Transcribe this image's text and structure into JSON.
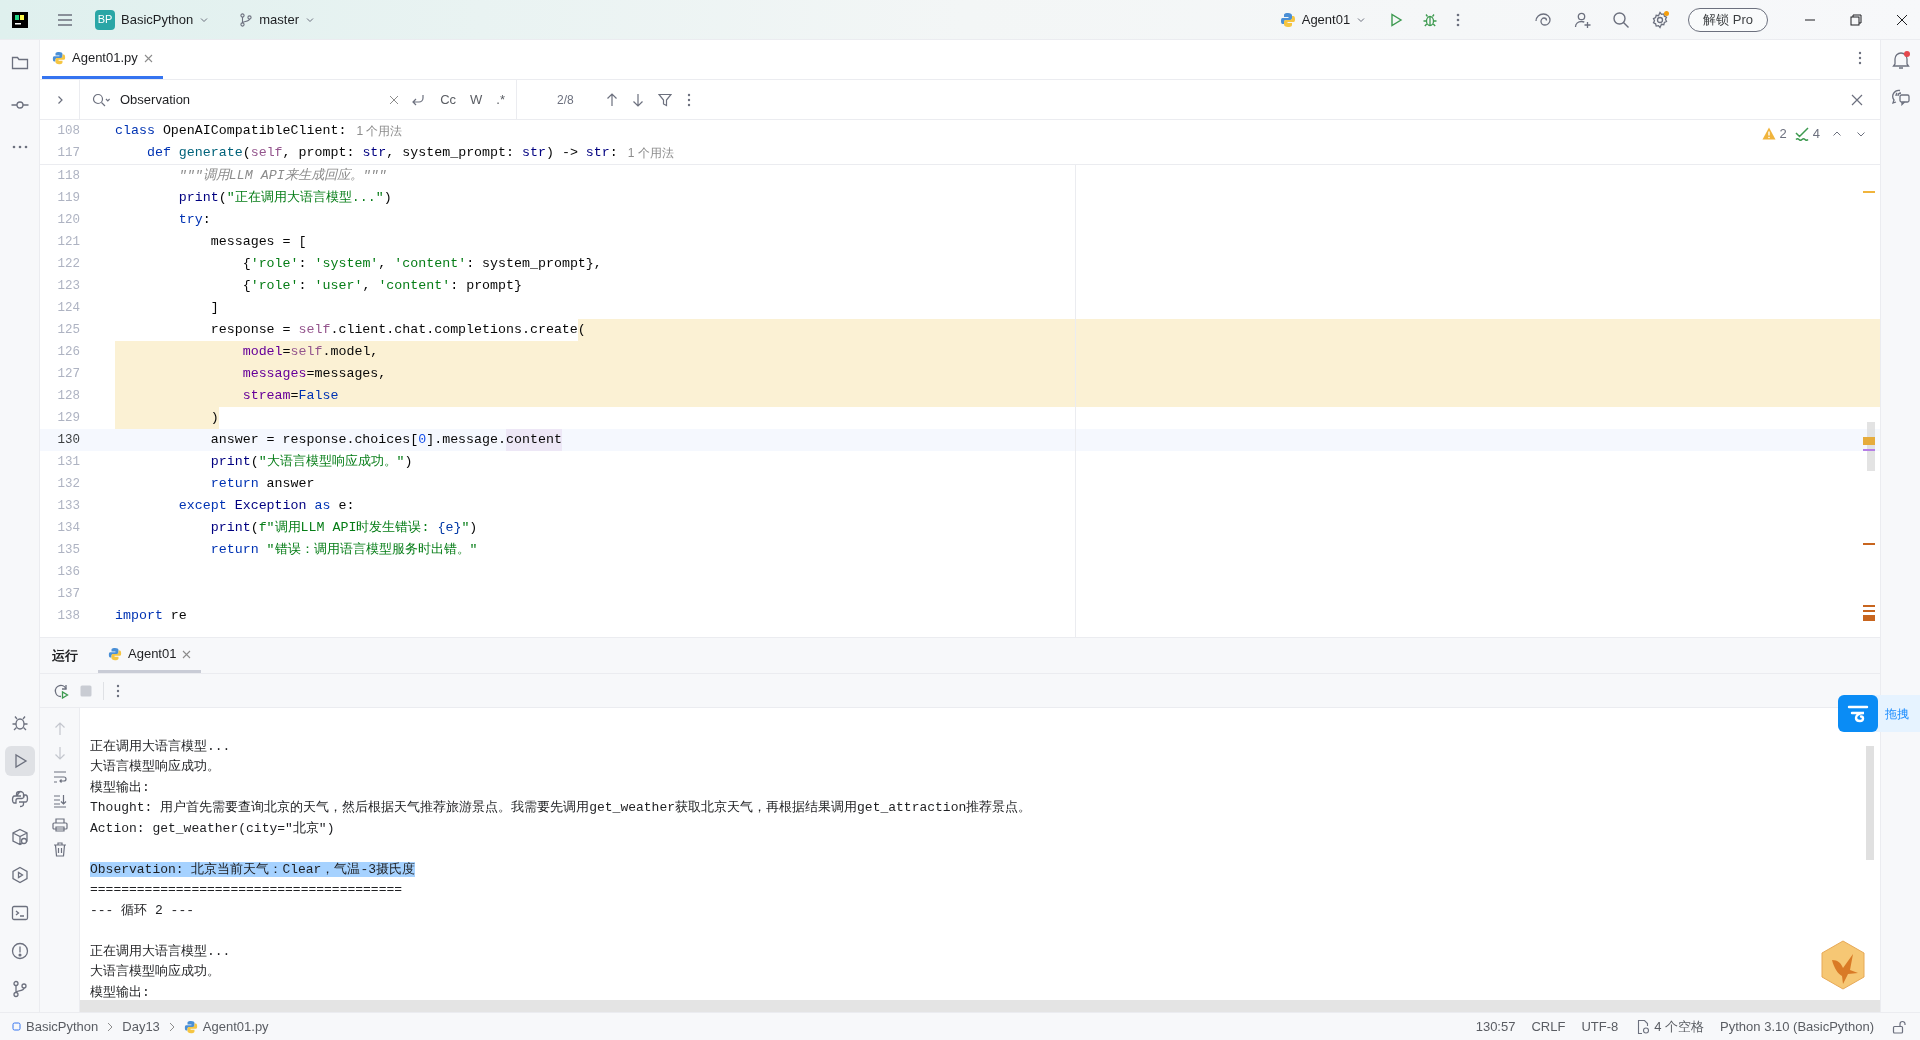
{
  "title_bar": {
    "project_badge": "BP",
    "project": "BasicPython",
    "branch": "master",
    "run_config": "Agent01",
    "pro_button": "解锁 Pro"
  },
  "left_toolbar": {
    "top": [
      {
        "kind": "folder",
        "selected": false
      },
      {
        "kind": "commit",
        "selected": false
      },
      {
        "kind": "more",
        "selected": false
      }
    ],
    "bottom": [
      {
        "kind": "bug",
        "selected": false
      },
      {
        "kind": "play",
        "selected": true
      },
      {
        "kind": "python",
        "selected": false
      },
      {
        "kind": "package",
        "selected": false
      },
      {
        "kind": "hexplay",
        "selected": false
      },
      {
        "kind": "terminal",
        "selected": false
      },
      {
        "kind": "alert",
        "selected": false
      },
      {
        "kind": "branch",
        "selected": false
      }
    ]
  },
  "editor_tabs": [
    {
      "label": "Agent01.py",
      "selected": true
    }
  ],
  "find_bar": {
    "value": "Observation",
    "options": [
      "Cc",
      "W",
      ".*"
    ],
    "match_count": "2/8"
  },
  "inspections": {
    "warnings": "2",
    "typos": "4"
  },
  "sticky_lines": [
    {
      "number": "108",
      "hint": "1 个用法",
      "tokens": [
        {
          "kind": "kw",
          "text": "class"
        },
        {
          "kind": "plain",
          "text": " OpenAICompatibleClient:"
        }
      ]
    },
    {
      "number": "117",
      "hint": "1 个用法",
      "tokens": [
        {
          "kind": "kw",
          "text": "    def"
        },
        {
          "kind": "fn",
          "text": " generate"
        },
        {
          "kind": "plain",
          "text": "("
        },
        {
          "kind": "self",
          "text": "self"
        },
        {
          "kind": "plain",
          "text": ", prompt: "
        },
        {
          "kind": "builtin",
          "text": "str"
        },
        {
          "kind": "plain",
          "text": ", system_prompt: "
        },
        {
          "kind": "builtin",
          "text": "str"
        },
        {
          "kind": "plain",
          "text": ") -> "
        },
        {
          "kind": "builtin",
          "text": "str"
        },
        {
          "kind": "plain",
          "text": ":"
        }
      ]
    }
  ],
  "code_lines": [
    {
      "number": "118",
      "tokens": [
        {
          "kind": "doc",
          "text": "        \"\"\"调用LLM API来生成回应。\"\"\""
        }
      ]
    },
    {
      "number": "119",
      "tokens": [
        {
          "kind": "builtin",
          "text": "        print"
        },
        {
          "kind": "plain",
          "text": "("
        },
        {
          "kind": "str",
          "text": "\"正在调用大语言模型...\""
        },
        {
          "kind": "plain",
          "text": ")"
        }
      ]
    },
    {
      "number": "120",
      "tokens": [
        {
          "kind": "kw",
          "text": "        try"
        },
        {
          "kind": "plain",
          "text": ":"
        }
      ]
    },
    {
      "number": "121",
      "tokens": [
        {
          "kind": "plain",
          "text": "            messages = ["
        }
      ]
    },
    {
      "number": "122",
      "tokens": [
        {
          "kind": "plain",
          "text": "                {"
        },
        {
          "kind": "str",
          "text": "'role'"
        },
        {
          "kind": "plain",
          "text": ": "
        },
        {
          "kind": "str",
          "text": "'system'"
        },
        {
          "kind": "plain",
          "text": ", "
        },
        {
          "kind": "str",
          "text": "'content'"
        },
        {
          "kind": "plain",
          "text": ": system_prompt},"
        }
      ]
    },
    {
      "number": "123",
      "tokens": [
        {
          "kind": "plain",
          "text": "                {"
        },
        {
          "kind": "str",
          "text": "'role'"
        },
        {
          "kind": "plain",
          "text": ": "
        },
        {
          "kind": "str",
          "text": "'user'"
        },
        {
          "kind": "plain",
          "text": ", "
        },
        {
          "kind": "str",
          "text": "'content'"
        },
        {
          "kind": "plain",
          "text": ": prompt}"
        }
      ]
    },
    {
      "number": "124",
      "tokens": [
        {
          "kind": "plain",
          "text": "            ]"
        }
      ]
    },
    {
      "number": "125",
      "tokens": [
        {
          "kind": "plain",
          "text": "            response = "
        },
        {
          "kind": "self",
          "text": "self"
        },
        {
          "kind": "plain",
          "text": ".client.chat.completions.create"
        },
        {
          "kind": "plain",
          "text": "(",
          "marked": true
        }
      ]
    },
    {
      "number": "126",
      "highlighted": true,
      "tokens": [
        {
          "kind": "param",
          "text": "                model"
        },
        {
          "kind": "plain",
          "text": "="
        },
        {
          "kind": "self",
          "text": "self"
        },
        {
          "kind": "plain",
          "text": ".model,"
        }
      ]
    },
    {
      "number": "127",
      "highlighted": true,
      "tokens": [
        {
          "kind": "param",
          "text": "                messages"
        },
        {
          "kind": "plain",
          "text": "=messages,"
        }
      ]
    },
    {
      "number": "128",
      "highlighted": true,
      "tokens": [
        {
          "kind": "param",
          "text": "                stream"
        },
        {
          "kind": "plain",
          "text": "="
        },
        {
          "kind": "kw",
          "text": "False"
        }
      ]
    },
    {
      "number": "129",
      "tokens": [
        {
          "kind": "plain",
          "text": "            )",
          "marked": true
        }
      ]
    },
    {
      "number": "130",
      "current": true,
      "tokens": [
        {
          "kind": "plain",
          "text": "            answer = response.choices["
        },
        {
          "kind": "num",
          "text": "0"
        },
        {
          "kind": "plain",
          "text": "].message."
        },
        {
          "kind": "usage",
          "text": "content"
        }
      ]
    },
    {
      "number": "131",
      "tokens": [
        {
          "kind": "builtin",
          "text": "            print"
        },
        {
          "kind": "plain",
          "text": "("
        },
        {
          "kind": "str",
          "text": "\"大语言模型响应成功。\""
        },
        {
          "kind": "plain",
          "text": ")"
        }
      ]
    },
    {
      "number": "132",
      "tokens": [
        {
          "kind": "kw",
          "text": "            return"
        },
        {
          "kind": "plain",
          "text": " answer"
        }
      ]
    },
    {
      "number": "133",
      "tokens": [
        {
          "kind": "kw",
          "text": "        except"
        },
        {
          "kind": "builtin",
          "text": " Exception"
        },
        {
          "kind": "kw",
          "text": " as"
        },
        {
          "kind": "plain",
          "text": " e:"
        }
      ]
    },
    {
      "number": "134",
      "tokens": [
        {
          "kind": "builtin",
          "text": "            print"
        },
        {
          "kind": "plain",
          "text": "("
        },
        {
          "kind": "str",
          "text": "f\"调用LLM API时发生错误: "
        },
        {
          "kind": "brace",
          "text": "{e}"
        },
        {
          "kind": "str",
          "text": "\""
        },
        {
          "kind": "plain",
          "text": ")"
        }
      ]
    },
    {
      "number": "135",
      "tokens": [
        {
          "kind": "kw",
          "text": "            return"
        },
        {
          "kind": "str",
          "text": " \"错误：调用语言模型服务时出错。\""
        }
      ]
    },
    {
      "number": "136"
    },
    {
      "number": "137"
    },
    {
      "number": "138",
      "tokens": [
        {
          "kind": "kw",
          "text": "import"
        },
        {
          "kind": "plain",
          "text": " re"
        }
      ]
    }
  ],
  "run_panel": {
    "title": "运行",
    "tabs": [
      {
        "label": "Agent01",
        "selected": true
      }
    ],
    "console": [
      {
        "kind": "blank"
      },
      {
        "kind": "text",
        "text": "正在调用大语言模型...",
        "selected": false
      },
      {
        "kind": "text",
        "text": "大语言模型响应成功。",
        "selected": false
      },
      {
        "kind": "text",
        "text": "模型输出:",
        "selected": false
      },
      {
        "kind": "text",
        "text": "Thought: 用户首先需要查询北京的天气，然后根据天气推荐旅游景点。我需要先调用get_weather获取北京天气，再根据结果调用get_attraction推荐景点。",
        "selected": false
      },
      {
        "kind": "text",
        "text": "Action: get_weather(city=\"北京\")",
        "selected": false
      },
      {
        "kind": "blank"
      },
      {
        "kind": "text",
        "text": "Observation: 北京当前天气：Clear，气温-3摄氏度",
        "selected": true
      },
      {
        "kind": "text",
        "text": "========================================",
        "selected": false
      },
      {
        "kind": "text",
        "text": "--- 循环 2 ---",
        "selected": false
      },
      {
        "kind": "blank"
      },
      {
        "kind": "text",
        "text": "正在调用大语言模型...",
        "selected": false
      },
      {
        "kind": "text",
        "text": "大语言模型响应成功。",
        "selected": false
      },
      {
        "kind": "text",
        "text": "模型输出:",
        "selected": false
      }
    ]
  },
  "status_bar": {
    "breadcrumbs": [
      "BasicPython",
      "Day13",
      "Agent01.py"
    ],
    "position": "130:57",
    "line_separator": "CRLF",
    "encoding": "UTF-8",
    "indent": "4 个空格",
    "interpreter": "Python 3.10 (BasicPython)"
  },
  "floating_widget": {
    "label": "拖拽"
  }
}
